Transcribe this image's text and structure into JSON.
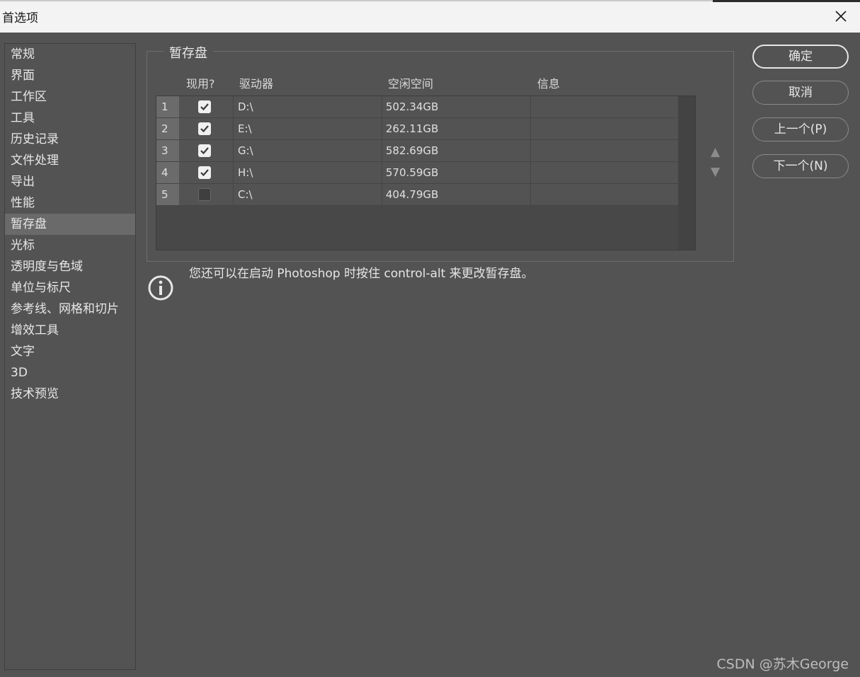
{
  "window": {
    "title": "首选项"
  },
  "sidebar": {
    "items": [
      {
        "label": "常规"
      },
      {
        "label": "界面"
      },
      {
        "label": "工作区"
      },
      {
        "label": "工具"
      },
      {
        "label": "历史记录"
      },
      {
        "label": "文件处理"
      },
      {
        "label": "导出"
      },
      {
        "label": "性能"
      },
      {
        "label": "暂存盘",
        "active": true
      },
      {
        "label": "光标"
      },
      {
        "label": "透明度与色域"
      },
      {
        "label": "单位与标尺"
      },
      {
        "label": "参考线、网格和切片"
      },
      {
        "label": "增效工具"
      },
      {
        "label": "文字"
      },
      {
        "label": "3D"
      },
      {
        "label": "技术预览"
      }
    ]
  },
  "scratch": {
    "group_title": "暂存盘",
    "columns": {
      "active": "现用?",
      "drive": "驱动器",
      "free": "空闲空间",
      "info": "信息"
    },
    "rows": [
      {
        "num": "1",
        "checked": true,
        "drive": "D:\\",
        "free": "502.34GB",
        "info": ""
      },
      {
        "num": "2",
        "checked": true,
        "drive": "E:\\",
        "free": "262.11GB",
        "info": ""
      },
      {
        "num": "3",
        "checked": true,
        "drive": "G:\\",
        "free": "582.69GB",
        "info": ""
      },
      {
        "num": "4",
        "checked": true,
        "drive": "H:\\",
        "free": "570.59GB",
        "info": ""
      },
      {
        "num": "5",
        "checked": false,
        "drive": "C:\\",
        "free": "404.79GB",
        "info": ""
      }
    ],
    "move_up": "▲",
    "move_down": "▼",
    "hint": "您还可以在启动 Photoshop 时按住 control-alt 来更改暂存盘。"
  },
  "buttons": {
    "ok": "确定",
    "cancel": "取消",
    "prev": "上一个(P)",
    "next": "下一个(N)"
  },
  "watermark": "CSDN @苏木George",
  "icons": {
    "close": "close-icon",
    "info": "info-icon",
    "check": "checkmark-icon"
  },
  "colors": {
    "background": "#535353",
    "titlebar": "#f3f3f3",
    "active_item": "#6a6a6a"
  }
}
